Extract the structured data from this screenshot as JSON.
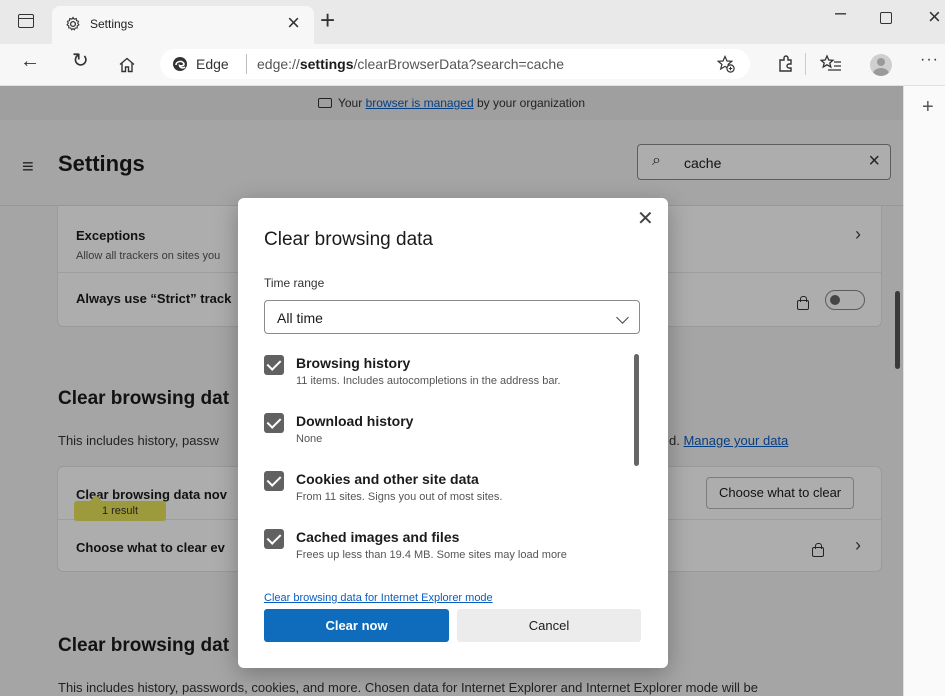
{
  "tab": {
    "title": "Settings"
  },
  "address": {
    "brand": "Edge",
    "url_prefix": "edge://",
    "url_bold": "settings",
    "url_rest": "/clearBrowserData?search=cache"
  },
  "banner": {
    "prefix": "Your ",
    "link": "browser is managed",
    "suffix": " by your organization"
  },
  "settings": {
    "title": "Settings",
    "search_value": "cache",
    "tracking_card": {
      "exceptions_title": "Exceptions",
      "exceptions_sub": "Allow all trackers on sites you",
      "strict_label": "Always use “Strict” track"
    },
    "section1": {
      "heading": "Clear browsing dat",
      "desc": "This includes history, passw",
      "desc_tail": "d.",
      "manage_link": "Manage your data"
    },
    "clear_card": {
      "row1_label": "Clear browsing data nov",
      "row1_button": "Choose what to clear",
      "result_chip": "1 result",
      "row2_label": "Choose what to clear ev"
    },
    "section2": {
      "heading": "Clear browsing dat",
      "desc": "This includes history, passwords, cookies, and more. Chosen data for Internet Explorer and Internet Explorer mode will be"
    }
  },
  "dialog": {
    "title": "Clear browsing data",
    "time_range_label": "Time range",
    "time_range_value": "All time",
    "options": [
      {
        "title": "Browsing history",
        "sub": "11 items. Includes autocompletions in the address bar.",
        "checked": true
      },
      {
        "title": "Download history",
        "sub": "None",
        "checked": true
      },
      {
        "title": "Cookies and other site data",
        "sub": "From 11 sites. Signs you out of most sites.",
        "checked": true
      },
      {
        "title": "Cached images and files",
        "sub": "Frees up less than 19.4 MB. Some sites may load more",
        "checked": true
      }
    ],
    "ie_link": "Clear browsing data for Internet Explorer mode",
    "clear_button": "Clear now",
    "cancel_button": "Cancel"
  },
  "colors": {
    "primary": "#0f6cbd",
    "link": "#0a5ec2",
    "checkbox": "#616161",
    "highlight": "#e8e45a"
  }
}
